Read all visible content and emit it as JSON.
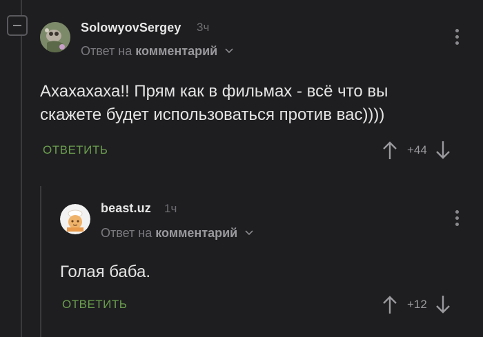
{
  "comment": {
    "username": "SolowyovSergey",
    "time": "3ч",
    "reply_prefix": "Ответ на",
    "reply_target": "комментарий",
    "text_line1": "Ахахахаха!! Прям как в фильмах - всё что вы",
    "text_line2": "скажете будет использоваться против вас))))",
    "reply_label": "ОТВЕТИТЬ",
    "score": "+44"
  },
  "reply": {
    "username": "beast.uz",
    "time": "1ч",
    "reply_prefix": "Ответ на",
    "reply_target": "комментарий",
    "text": "Голая баба.",
    "reply_label": "ОТВЕТИТЬ",
    "score": "+12"
  },
  "colors": {
    "background": "#1e1e20",
    "accent_green": "#6b9e4e",
    "muted": "#7b7b80"
  },
  "icons": [
    "collapse-icon",
    "chevron-down-icon",
    "more-options-icon",
    "upvote-arrow-icon",
    "downvote-arrow-icon"
  ]
}
